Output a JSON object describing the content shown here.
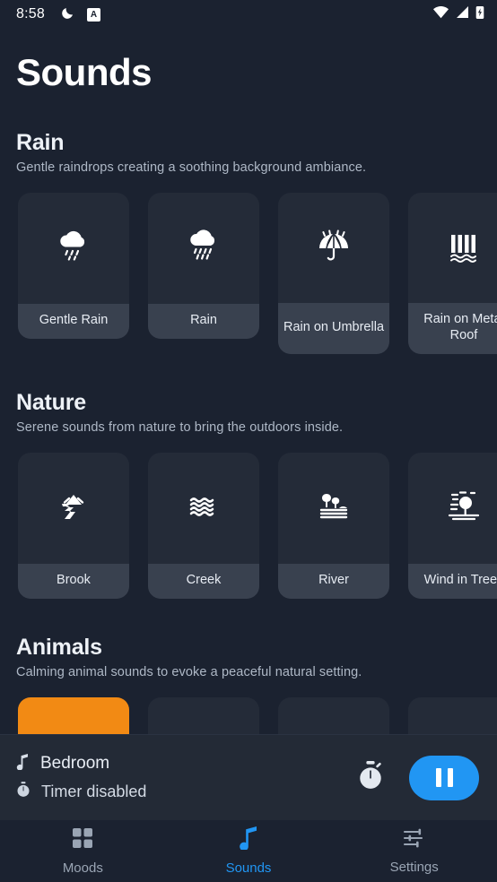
{
  "status_bar": {
    "time": "8:58",
    "left_icons": [
      "do-not-disturb-moon-icon",
      "accessibility-a-icon"
    ],
    "a_badge": "A",
    "right_icons": [
      "wifi-icon",
      "cellular-signal-icon",
      "battery-charging-icon"
    ]
  },
  "header": {
    "title": "Sounds"
  },
  "sections": [
    {
      "title": "Rain",
      "subtitle": "Gentle raindrops creating a soothing background ambiance.",
      "cards": [
        {
          "label": "Gentle Rain",
          "icon": "cloud-light-rain-icon",
          "active": false,
          "lines": 1
        },
        {
          "label": "Rain",
          "icon": "cloud-heavy-rain-icon",
          "active": false,
          "lines": 1
        },
        {
          "label": "Rain on Umbrella",
          "icon": "umbrella-rain-icon",
          "active": false,
          "lines": 2
        },
        {
          "label": "Rain on Metal Roof",
          "icon": "metal-roof-icon",
          "active": false,
          "lines": 2
        }
      ]
    },
    {
      "title": "Nature",
      "subtitle": "Serene sounds from nature to bring the outdoors inside.",
      "cards": [
        {
          "label": "Brook",
          "icon": "brook-stream-icon",
          "active": false,
          "lines": 1
        },
        {
          "label": "Creek",
          "icon": "water-waves-icon",
          "active": false,
          "lines": 1
        },
        {
          "label": "River",
          "icon": "river-trees-icon",
          "active": false,
          "lines": 1
        },
        {
          "label": "Wind in Trees",
          "icon": "wind-in-trees-icon",
          "active": false,
          "lines": 1
        }
      ]
    },
    {
      "title": "Animals",
      "subtitle": "Calming animal sounds to evoke a peaceful natural setting.",
      "cards": [
        {
          "label": "",
          "icon": "animal-icon",
          "active": true,
          "lines": 1
        },
        {
          "label": "",
          "icon": "animal-icon",
          "active": false,
          "lines": 1
        },
        {
          "label": "",
          "icon": "animal-icon",
          "active": false,
          "lines": 1
        },
        {
          "label": "",
          "icon": "animal-icon",
          "active": false,
          "lines": 1
        }
      ]
    }
  ],
  "player": {
    "track_icon": "music-note-icon",
    "track_name": "Bedroom",
    "timer_icon": "stopwatch-icon",
    "timer_status": "Timer disabled",
    "timer_button_icon": "stopwatch-icon",
    "play_button_icon": "pause-icon",
    "play_button_color": "#2196f3"
  },
  "nav": {
    "items": [
      {
        "label": "Moods",
        "icon": "grid-icon",
        "active": false
      },
      {
        "label": "Sounds",
        "icon": "music-note-icon",
        "active": true
      },
      {
        "label": "Settings",
        "icon": "sliders-icon",
        "active": false
      }
    ],
    "active_color": "#2196f3",
    "inactive_color": "#9aa5b4"
  }
}
